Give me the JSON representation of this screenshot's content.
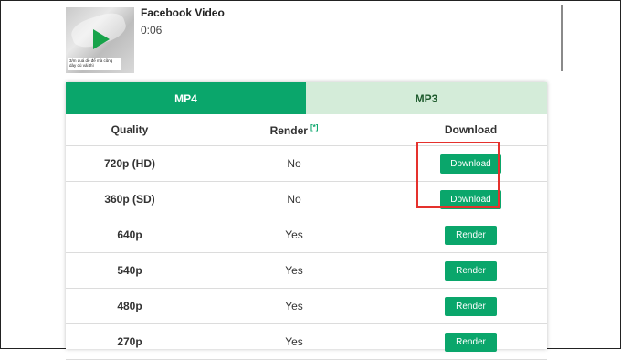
{
  "video": {
    "title": "Facebook Video",
    "duration": "0:06",
    "thumbnail_caption": "3/m quá dễ để mà cũng dày đủ vải thì"
  },
  "tabs": [
    {
      "label": "MP4",
      "active": true
    },
    {
      "label": "MP3",
      "active": false
    }
  ],
  "table": {
    "headers": {
      "quality": "Quality",
      "render": "Render",
      "render_info": "[*]",
      "download": "Download"
    },
    "rows": [
      {
        "quality": "720p (HD)",
        "render": "No",
        "action": "Download"
      },
      {
        "quality": "360p (SD)",
        "render": "No",
        "action": "Download"
      },
      {
        "quality": "640p",
        "render": "Yes",
        "action": "Render"
      },
      {
        "quality": "540p",
        "render": "Yes",
        "action": "Render"
      },
      {
        "quality": "480p",
        "render": "Yes",
        "action": "Render"
      },
      {
        "quality": "270p",
        "render": "Yes",
        "action": "Render"
      }
    ]
  },
  "colors": {
    "accent": "#0aa66b",
    "tab_inactive": "#d4ecd9",
    "highlight": "#e5312d"
  },
  "icons": {
    "thumbnail_play": "play-icon"
  }
}
